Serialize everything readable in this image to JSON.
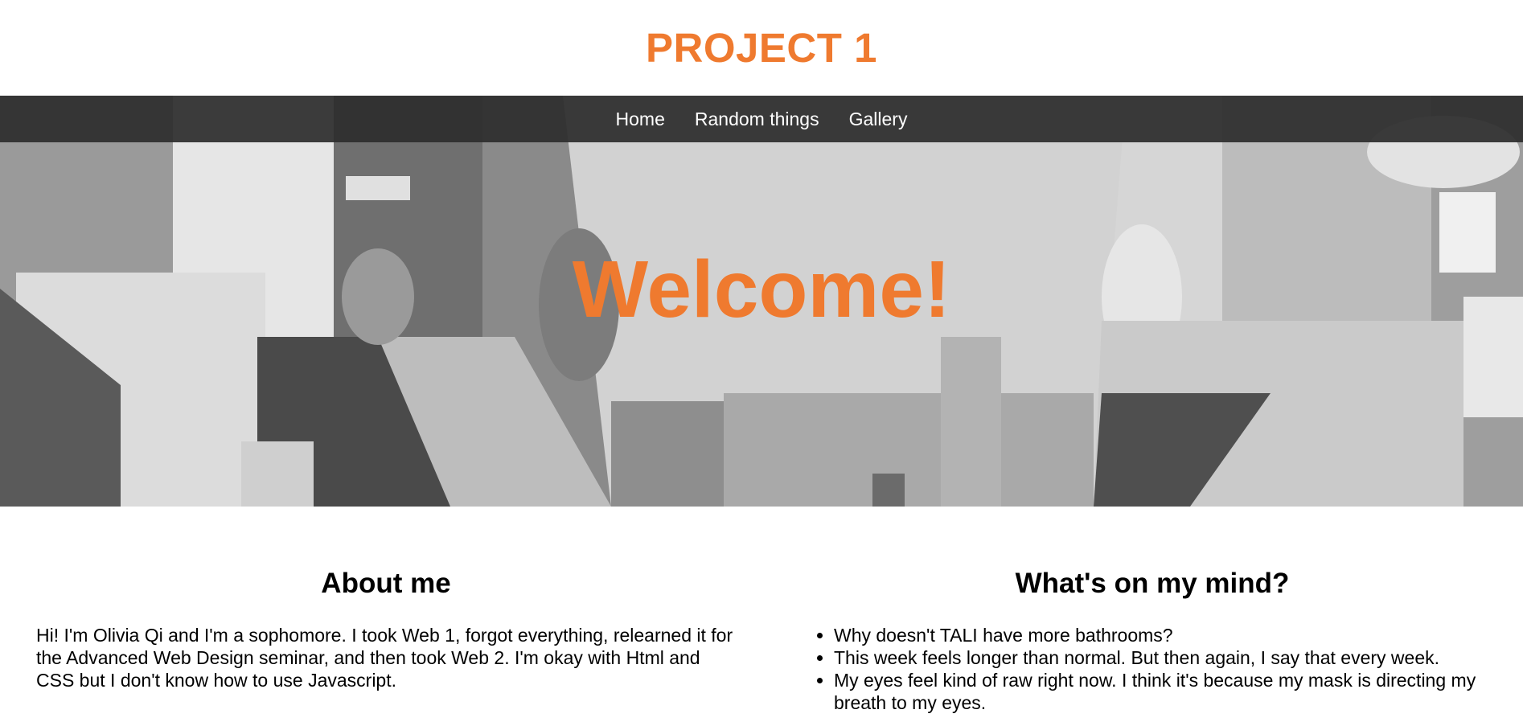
{
  "site": {
    "title": "PROJECT 1"
  },
  "nav": {
    "items": [
      {
        "label": "Home"
      },
      {
        "label": "Random things"
      },
      {
        "label": "Gallery"
      }
    ]
  },
  "hero": {
    "heading": "Welcome!"
  },
  "about": {
    "heading": "About me",
    "paragraphs": [
      "Hi! I'm Olivia Qi and I'm a sophomore. I took Web 1, forgot everything, relearned it for the Advanced Web Design seminar, and then took Web 2. I'm okay with Html and CSS but I don't know how to use Javascript."
    ]
  },
  "mind": {
    "heading": "What's on my mind?",
    "items": [
      "Why doesn't TALI have more bathrooms?",
      "This week feels longer than normal. But then again, I say that every week.",
      "My eyes feel kind of raw right now. I think it's because my mask is directing my breath to my eyes."
    ]
  },
  "colors": {
    "accent": "#ef7a2f",
    "nav_bg": "#2d2d2d"
  }
}
